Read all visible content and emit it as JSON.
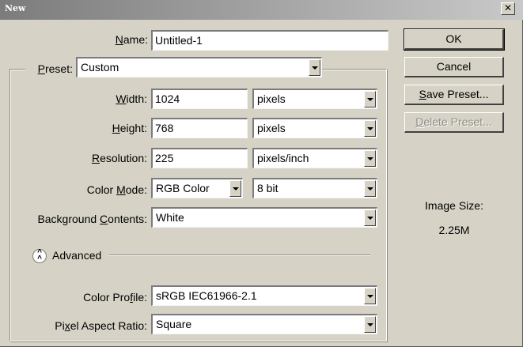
{
  "window": {
    "title": "New",
    "close_glyph": "✕"
  },
  "fields": {
    "name": {
      "label_u": "N",
      "label_rest": "ame:",
      "value": "Untitled-1"
    },
    "preset": {
      "label_u": "P",
      "label_rest": "reset:",
      "value": "Custom"
    },
    "width": {
      "label_u": "W",
      "label_rest": "idth:",
      "value": "1024",
      "unit": "pixels"
    },
    "height": {
      "label_u": "H",
      "label_rest": "eight:",
      "value": "768",
      "unit": "pixels"
    },
    "resolution": {
      "label_u": "R",
      "label_rest": "esolution:",
      "value": "225",
      "unit": "pixels/inch"
    },
    "color_mode": {
      "label_pre": "Color ",
      "label_u": "M",
      "label_rest": "ode:",
      "value": "RGB Color",
      "depth": "8 bit"
    },
    "background": {
      "label_pre": "Background ",
      "label_u": "C",
      "label_rest": "ontents:",
      "value": "White"
    },
    "advanced_label": "Advanced",
    "color_profile": {
      "label_pre": "Color Pro",
      "label_u": "f",
      "label_rest": "ile:",
      "value": "sRGB IEC61966-2.1"
    },
    "pixel_aspect": {
      "label_pre": "Pi",
      "label_u": "x",
      "label_rest": "el Aspect Ratio:",
      "value": "Square"
    }
  },
  "buttons": {
    "ok": "OK",
    "cancel": "Cancel",
    "save_preset_u": "S",
    "save_preset_rest": "ave Preset...",
    "delete_preset_u": "D",
    "delete_preset_rest": "elete Preset..."
  },
  "info": {
    "image_size_label": "Image Size:",
    "image_size_value": "2.25M"
  },
  "icons": {
    "advanced_toggle": "chevron-double-up-icon",
    "dropdown_arrow": "triangle-down-icon"
  }
}
